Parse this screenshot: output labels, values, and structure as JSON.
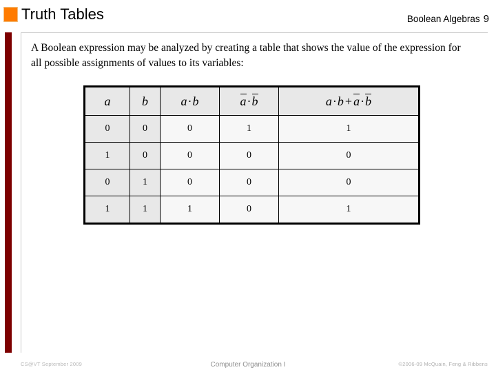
{
  "header": {
    "title": "Truth Tables",
    "right_label": "Boolean Algebras",
    "slide_number": "9",
    "accent_orange": "#ff7b00",
    "accent_maroon": "#7d0000"
  },
  "body": {
    "paragraph": "A Boolean expression may be analyzed by creating a table that shows the value of the expression for all possible assignments of values to its variables:"
  },
  "table": {
    "headers": [
      {
        "plain": "a",
        "parts": [
          {
            "text": "a",
            "over": false
          }
        ]
      },
      {
        "plain": "b",
        "parts": [
          {
            "text": "b",
            "over": false
          }
        ]
      },
      {
        "plain": "a·b",
        "parts": [
          {
            "text": "a",
            "over": false
          },
          {
            "op": "·"
          },
          {
            "text": "b",
            "over": false
          }
        ]
      },
      {
        "plain": "ā·b̄",
        "parts": [
          {
            "text": "a",
            "over": true
          },
          {
            "op": "·"
          },
          {
            "text": "b",
            "over": true
          }
        ]
      },
      {
        "plain": "a·b+ā·b̄",
        "parts": [
          {
            "text": "a",
            "over": false
          },
          {
            "op": "·"
          },
          {
            "text": "b",
            "over": false
          },
          {
            "plus": "+"
          },
          {
            "text": "a",
            "over": true
          },
          {
            "op": "·"
          },
          {
            "text": "b",
            "over": true
          }
        ]
      }
    ],
    "rows": [
      [
        "0",
        "0",
        "0",
        "1",
        "1"
      ],
      [
        "1",
        "0",
        "0",
        "0",
        "0"
      ],
      [
        "0",
        "1",
        "0",
        "0",
        "0"
      ],
      [
        "1",
        "1",
        "1",
        "0",
        "1"
      ]
    ],
    "header_bg": "#e8e8e8",
    "var_col_bg": "#e8e8e8",
    "value_col_bg": "#f7f7f7"
  },
  "footer": {
    "left": "CS@VT September 2009",
    "center": "Computer Organization I",
    "right": "©2006-09 McQuain, Feng & Ribbens"
  }
}
